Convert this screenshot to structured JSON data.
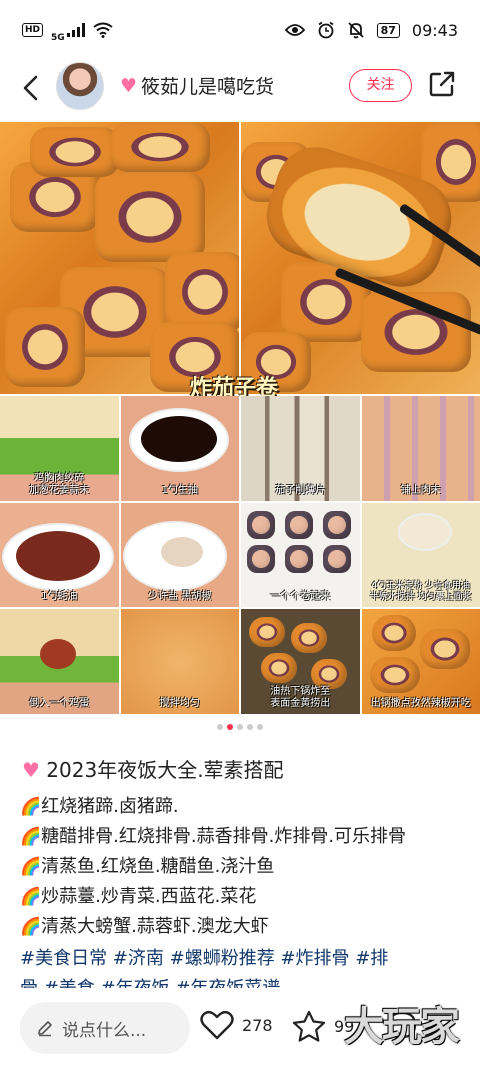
{
  "status_bar": {
    "hd": "HD",
    "network": "5G",
    "battery": "87",
    "time": "09:43"
  },
  "header": {
    "author": "筱茹儿是噶吃货",
    "follow_label": "关注"
  },
  "image": {
    "top_caption": "炸茄子卷",
    "steps": [
      "鸡胸肉绞碎\n加葱花姜蒜末",
      "1勺生抽",
      "茄子削薄片",
      "铺上肉末",
      "1勺蚝油",
      "少许盐 黑胡椒",
      "一个个卷起来",
      "4勺玉米淀粉 少许食用油\n半碗水搅拌 均匀裹上面浆",
      "倒入一个鸡蛋",
      "搅拌均匀",
      "油热下锅炸至\n表面金黄捞出",
      "出锅撒点孜然辣椒开吃"
    ],
    "page_count": 5,
    "active_page": 2
  },
  "post": {
    "title": "2023年夜饭大全.荤素搭配",
    "lines": [
      "红烧猪蹄.卤猪蹄.",
      "糖醋排骨.红烧排骨.蒜香排骨.炸排骨.可乐排骨",
      "清蒸鱼.红烧鱼.糖醋鱼.浇汁鱼",
      "炒蒜薹.炒青菜.西蓝花.菜花",
      "清蒸大螃蟹.蒜蓉虾.澳龙大虾"
    ],
    "tags_line1": "#美食日常 #济南 #螺蛳粉推荐 #炸排骨 #排",
    "tags_line2": "骨 #美食 #年夜饭 #年夜饭菜谱"
  },
  "bottom_bar": {
    "comment_placeholder": "说点什么...",
    "likes": "278",
    "favorites": "99",
    "watermark": "大玩家"
  },
  "colors": {
    "accent": "#ff2e4d",
    "tag": "#13386c"
  }
}
